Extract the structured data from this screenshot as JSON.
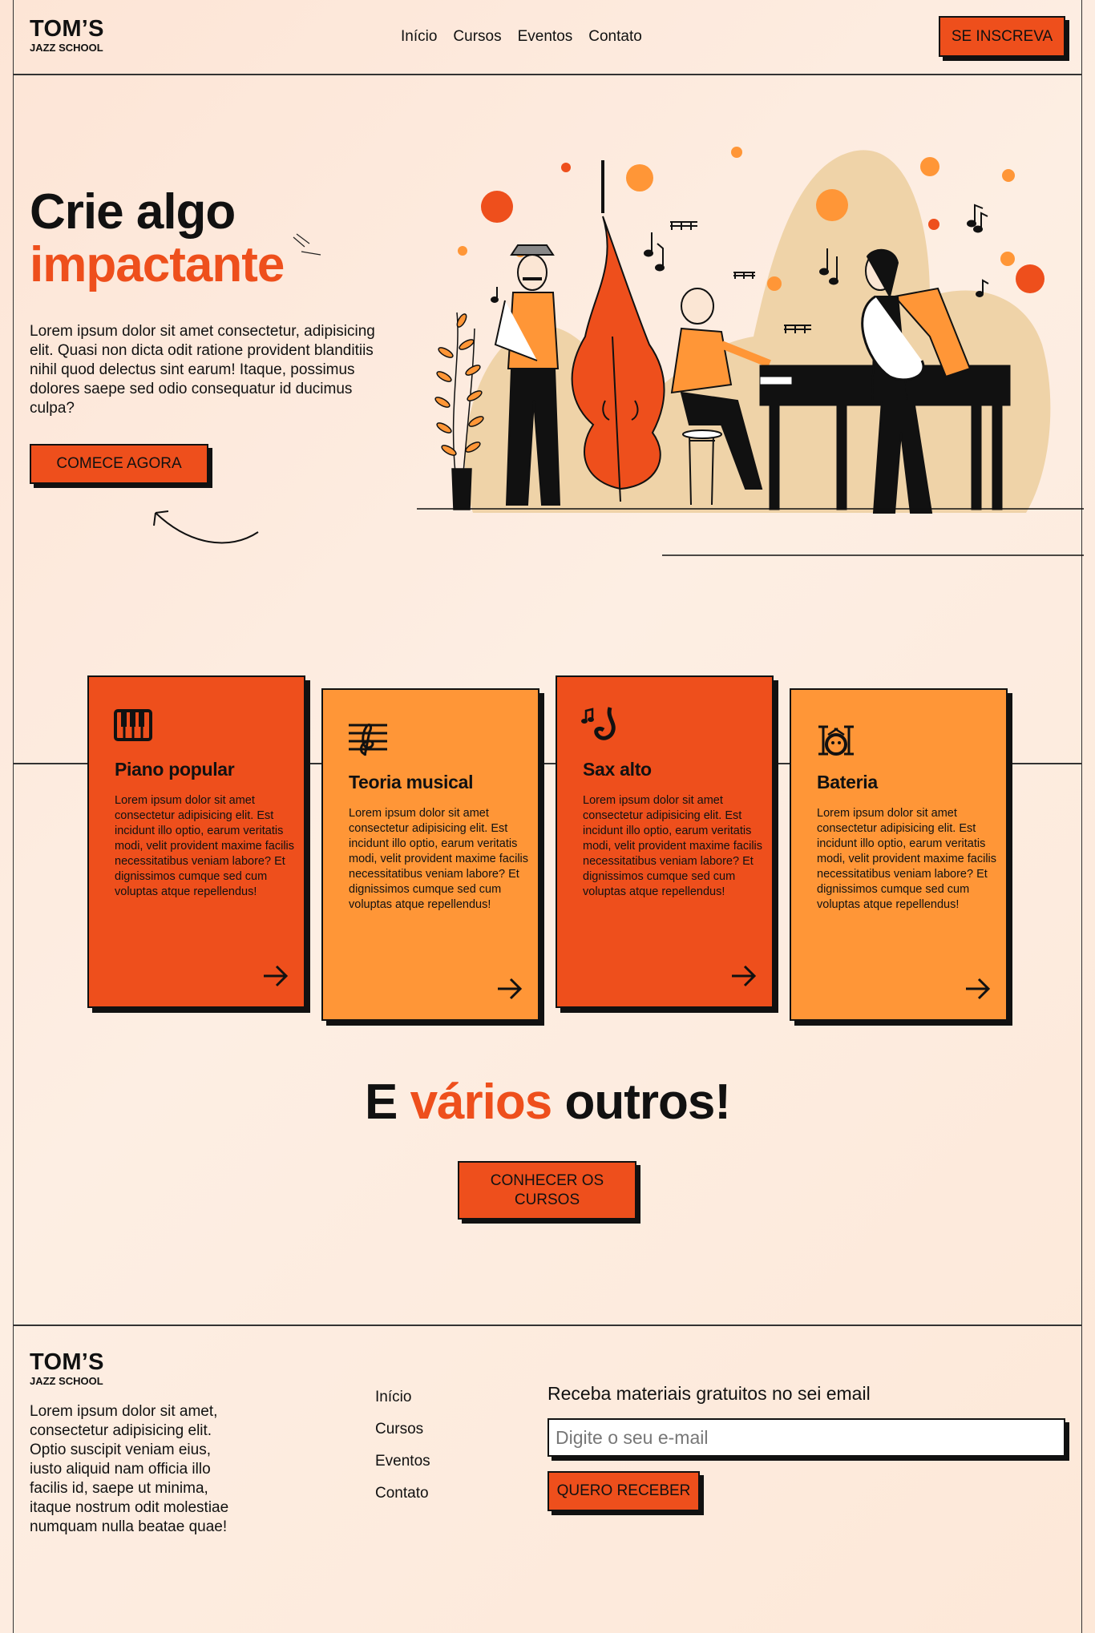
{
  "brand": {
    "name": "TOM’S",
    "sub": "JAZZ SCHOOL"
  },
  "nav": [
    "Início",
    "Cursos",
    "Eventos",
    "Contato"
  ],
  "header_cta": "SE INSCREVA",
  "hero": {
    "title_line1": "Crie algo",
    "title_line2": "impactante",
    "text": "Lorem ipsum dolor sit amet consectetur, adipisicing elit. Quasi non dicta odit ratione provident blanditiis nihil quod delectus sint earum! Itaque, possimus dolores saepe sed odio consequatur id ducimus culpa?",
    "cta": "COMECE AGORA"
  },
  "courses": [
    {
      "title": "Piano popular",
      "icon": "piano-icon",
      "color": "#ee4f1c",
      "text": "Lorem ipsum dolor sit amet consectetur adipisicing elit. Est incidunt illo optio, earum veritatis modi, velit provident maxime facilis necessitatibus veniam labore? Et dignissimos cumque sed cum voluptas atque repellendus!"
    },
    {
      "title": "Teoria musical",
      "icon": "music-staff-icon",
      "color": "#ff9637",
      "text": "Lorem ipsum dolor sit amet consectetur adipisicing elit. Est incidunt illo optio, earum veritatis modi, velit provident maxime facilis necessitatibus veniam labore? Et dignissimos cumque sed cum voluptas atque repellendus!"
    },
    {
      "title": "Sax alto",
      "icon": "saxophone-icon",
      "color": "#ee4f1c",
      "text": "Lorem ipsum dolor sit amet consectetur adipisicing elit. Est incidunt illo optio, earum veritatis modi, velit provident maxime facilis necessitatibus veniam labore? Et dignissimos cumque sed cum voluptas atque repellendus!"
    },
    {
      "title": "Bateria",
      "icon": "drums-icon",
      "color": "#ff9637",
      "text": "Lorem ipsum dolor sit amet consectetur adipisicing elit. Est incidunt illo optio, earum veritatis modi, velit provident maxime facilis necessitatibus veniam labore? Et dignissimos cumque sed cum voluptas atque repellendus!"
    }
  ],
  "others": {
    "part1": "E",
    "accent": "vários",
    "part2": "outros!",
    "cta": "CONHECER OS CURSOS"
  },
  "footer": {
    "text": "Lorem ipsum dolor sit amet, consectetur adipisicing elit. Optio suscipit veniam eius, iusto aliquid nam officia illo facilis id, saepe ut minima, itaque nostrum odit molestiae numquam nulla beatae quae!",
    "nav": [
      "Início",
      "Cursos",
      "Eventos",
      "Contato"
    ],
    "newsletter_title": "Receba materiais gratuitos no sei email",
    "email_placeholder": "Digite o seu e-mail",
    "cta": "QUERO RECEBER"
  },
  "colors": {
    "accent": "#ee4f1c",
    "orange": "#ff9637",
    "beige": "#efd3a8",
    "ink": "#111111"
  }
}
